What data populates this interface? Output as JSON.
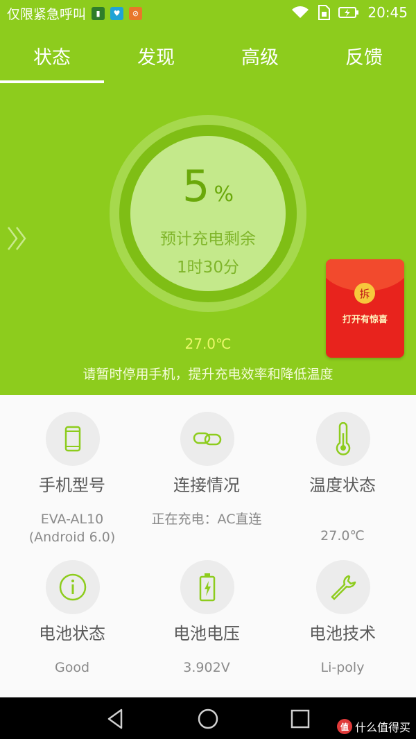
{
  "status_bar": {
    "carrier_text": "仅限紧急呼叫",
    "time": "20:45",
    "notification_icons": [
      "battery-app-icon",
      "health-app-icon",
      "blocked-app-icon"
    ],
    "status_icons": [
      "wifi-icon",
      "sim-icon",
      "battery-charging-icon"
    ]
  },
  "tabs": [
    {
      "label": "状态",
      "active": true
    },
    {
      "label": "发现",
      "active": false
    },
    {
      "label": "高级",
      "active": false
    },
    {
      "label": "反馈",
      "active": false
    }
  ],
  "hero": {
    "percent_value": "5",
    "percent_unit": "%",
    "remaining_label": "预计充电剩余",
    "remaining_time": "1时30分",
    "temperature": "27.0℃",
    "tip": "请暂时停用手机，提升充电效率和降低温度"
  },
  "red_packet": {
    "seal_char": "拆",
    "text": "打开有惊喜"
  },
  "info_cards": [
    {
      "icon": "phone-icon",
      "title": "手机型号",
      "value": "EVA-AL10 (Android 6.0)"
    },
    {
      "icon": "link-icon",
      "title": "连接情况",
      "value": "正在充电：AC直连"
    },
    {
      "icon": "thermometer-icon",
      "title": "温度状态",
      "value": "27.0℃"
    },
    {
      "icon": "info-icon",
      "title": "电池状态",
      "value": "Good"
    },
    {
      "icon": "battery-icon",
      "title": "电池电压",
      "value": "3.902V"
    },
    {
      "icon": "wrench-icon",
      "title": "电池技术",
      "value": "Li-poly"
    }
  ],
  "watermark": {
    "badge": "值",
    "text": "什么值得买"
  },
  "colors": {
    "brand_green": "#8dcc1d",
    "icon_green": "#8dcc1d",
    "red_packet": "#e8231d"
  }
}
